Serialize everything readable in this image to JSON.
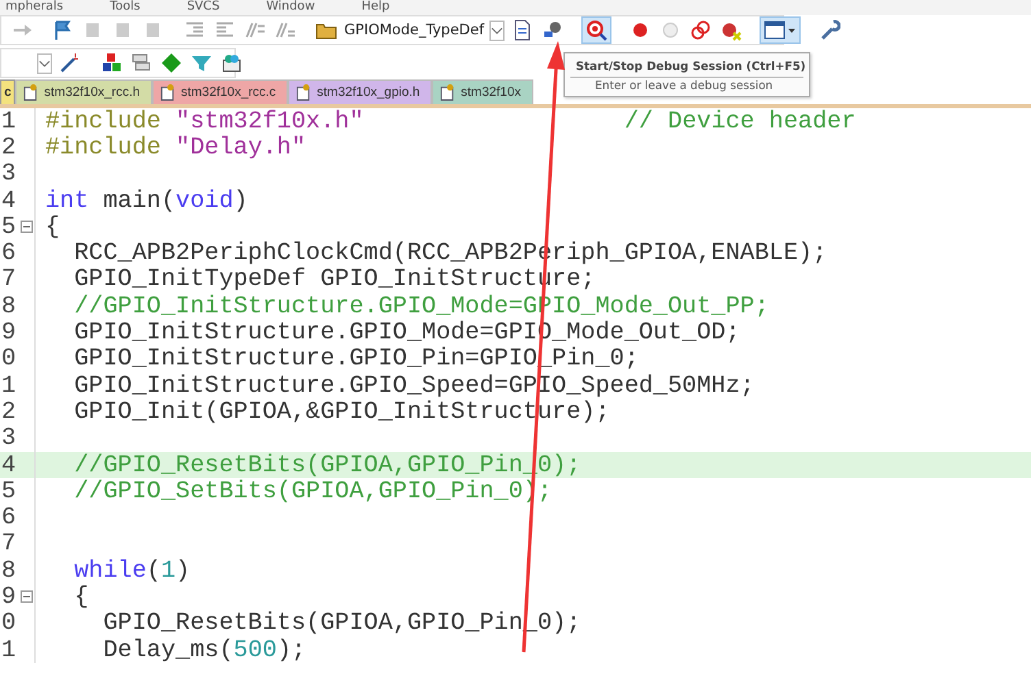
{
  "menu": [
    "mpherals",
    "Tools",
    "SVCS",
    "Window",
    "Help"
  ],
  "toolbar": {
    "combo_value": "GPIOMode_TypeDef"
  },
  "tooltip": {
    "title": "Start/Stop Debug Session (Ctrl+F5)",
    "description": "Enter or leave a debug session"
  },
  "tabs": [
    {
      "label": "c",
      "selected": true,
      "color": "#f3e27e"
    },
    {
      "label": "stm32f10x_rcc.h",
      "selected": false,
      "color": "#d3dca6"
    },
    {
      "label": "stm32f10x_rcc.c",
      "selected": false,
      "color": "#eea6a6"
    },
    {
      "label": "stm32f10x_gpio.h",
      "selected": false,
      "color": "#d0b6ea"
    },
    {
      "label": "stm32f10x",
      "selected": false,
      "color": "#a9d3c3"
    }
  ],
  "code_lines": [
    {
      "number": "1",
      "highlighted": false,
      "fold": false,
      "segments": [
        {
          "kind": "pp",
          "text": "#include "
        },
        {
          "kind": "str",
          "text": "\"stm32f10x.h\""
        },
        {
          "kind": "comment",
          "text": "                  // Device header"
        }
      ]
    },
    {
      "number": "2",
      "highlighted": false,
      "fold": false,
      "segments": [
        {
          "kind": "pp",
          "text": "#include "
        },
        {
          "kind": "str",
          "text": "\"Delay.h\""
        }
      ]
    },
    {
      "number": "3",
      "highlighted": false,
      "fold": false
    },
    {
      "number": "4",
      "highlighted": false,
      "fold": false,
      "segments": [
        {
          "kind": "kw",
          "text": "int"
        },
        {
          "kind": "plain",
          "text": " main("
        },
        {
          "kind": "kw",
          "text": "void"
        },
        {
          "kind": "plain",
          "text": ")"
        }
      ]
    },
    {
      "number": "5",
      "highlighted": false,
      "fold": true,
      "segments": [
        {
          "kind": "plain",
          "text": "{"
        }
      ]
    },
    {
      "number": "6",
      "highlighted": false,
      "fold": false,
      "segments": [
        {
          "kind": "plain",
          "text": "  RCC_APB2PeriphClockCmd(RCC_APB2Periph_GPIOA,ENABLE);"
        }
      ]
    },
    {
      "number": "7",
      "highlighted": false,
      "fold": false,
      "segments": [
        {
          "kind": "plain",
          "text": "  GPIO_InitTypeDef GPIO_InitStructure;"
        }
      ]
    },
    {
      "number": "8",
      "highlighted": false,
      "fold": false,
      "segments": [
        {
          "kind": "comment",
          "text": "  //GPIO_InitStructure.GPIO_Mode=GPIO_Mode_Out_PP;"
        }
      ]
    },
    {
      "number": "9",
      "highlighted": false,
      "fold": false,
      "segments": [
        {
          "kind": "plain",
          "text": "  GPIO_InitStructure.GPIO_Mode=GPIO_Mode_Out_OD;"
        }
      ]
    },
    {
      "number": "0",
      "highlighted": false,
      "fold": false,
      "segments": [
        {
          "kind": "plain",
          "text": "  GPIO_InitStructure.GPIO_Pin=GPIO_Pin_0;"
        }
      ]
    },
    {
      "number": "1",
      "highlighted": false,
      "fold": false,
      "segments": [
        {
          "kind": "plain",
          "text": "  GPIO_InitStructure.GPIO_Speed=GPIO_Speed_50MHz;"
        }
      ]
    },
    {
      "number": "2",
      "highlighted": false,
      "fold": false,
      "segments": [
        {
          "kind": "plain",
          "text": "  GPIO_Init(GPIOA,&GPIO_InitStructure);"
        }
      ]
    },
    {
      "number": "3",
      "highlighted": false,
      "fold": false
    },
    {
      "number": "4",
      "highlighted": true,
      "fold": false,
      "segments": [
        {
          "kind": "comment",
          "text": "  //GPIO_ResetBits(GPIOA,GPIO_Pin_0);"
        }
      ]
    },
    {
      "number": "5",
      "highlighted": false,
      "fold": false,
      "segments": [
        {
          "kind": "comment",
          "text": "  //GPIO_SetBits(GPIOA,GPIO_Pin_0);"
        }
      ]
    },
    {
      "number": "6",
      "highlighted": false,
      "fold": false
    },
    {
      "number": "7",
      "highlighted": false,
      "fold": false
    },
    {
      "number": "8",
      "highlighted": false,
      "fold": false,
      "segments": [
        {
          "kind": "kw",
          "text": "  while"
        },
        {
          "kind": "plain",
          "text": "("
        },
        {
          "kind": "num",
          "text": "1"
        },
        {
          "kind": "plain",
          "text": ")"
        }
      ]
    },
    {
      "number": "9",
      "highlighted": false,
      "fold": true,
      "segments": [
        {
          "kind": "plain",
          "text": "  {"
        }
      ]
    },
    {
      "number": "0",
      "highlighted": false,
      "fold": false,
      "segments": [
        {
          "kind": "plain",
          "text": "    GPIO_ResetBits(GPIOA,GPIO_Pin_0);"
        }
      ]
    },
    {
      "number": "1",
      "highlighted": false,
      "fold": false,
      "segments": [
        {
          "kind": "plain",
          "text": "    Delay_ms("
        },
        {
          "kind": "num",
          "text": "500"
        },
        {
          "kind": "plain",
          "text": ");"
        }
      ]
    }
  ]
}
